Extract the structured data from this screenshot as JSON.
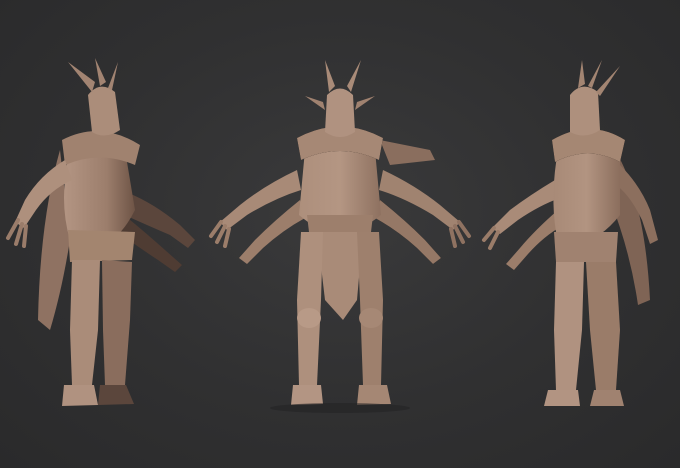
{
  "scene": {
    "background_color": "#2f2f30",
    "clay_color": "#a88a78",
    "clay_shadow_color": "#5b463c",
    "views": [
      {
        "name": "three-quarter-left"
      },
      {
        "name": "front"
      },
      {
        "name": "three-quarter-right"
      }
    ]
  }
}
